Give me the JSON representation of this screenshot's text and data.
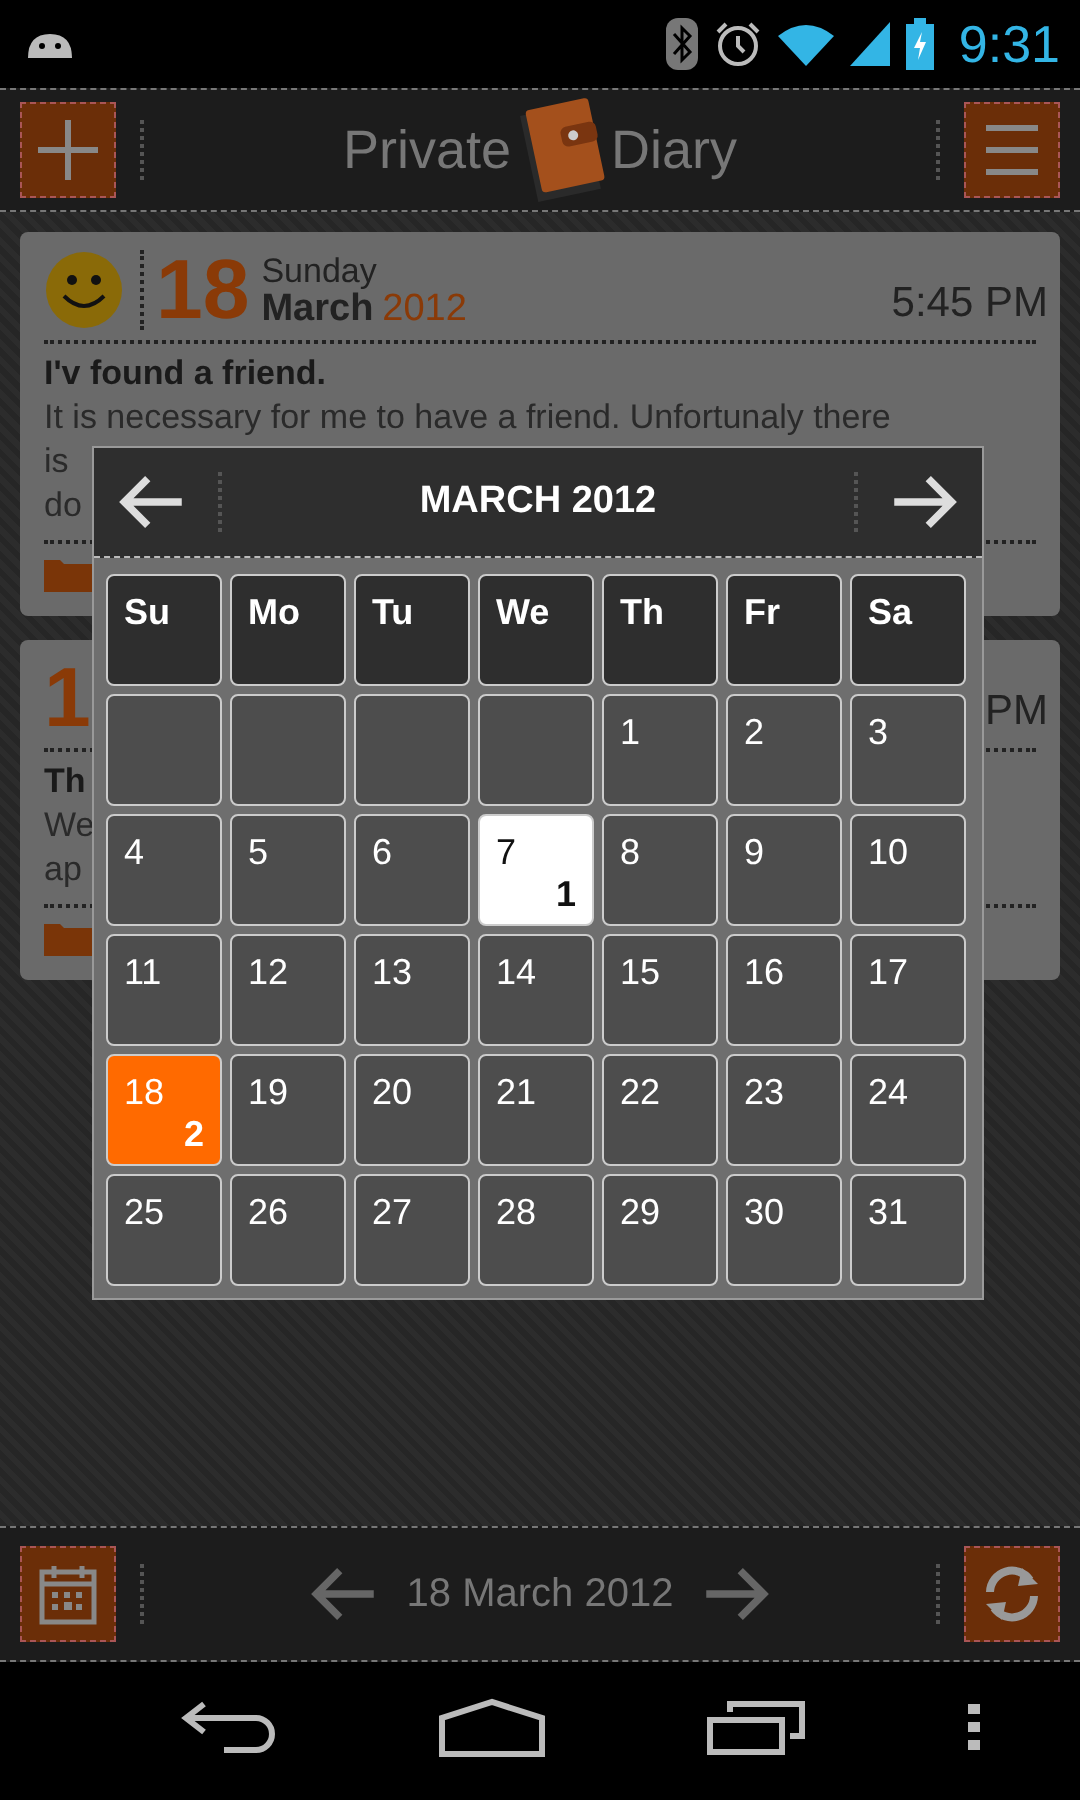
{
  "status_bar": {
    "time": "9:31"
  },
  "header": {
    "title_left": "Private",
    "title_right": "Diary"
  },
  "entries": [
    {
      "day": "18",
      "weekday": "Sunday",
      "month": "March",
      "year": "2012",
      "time": "5:45 PM",
      "title": "I'v found a friend.",
      "lines": [
        "It is necessary for me to have a friend. Unfortunaly there",
        "is",
        "do"
      ]
    },
    {
      "day": "1",
      "time": "PM",
      "title": "Th",
      "lines": [
        "We",
        "ap"
      ]
    }
  ],
  "calendar": {
    "title": "MARCH 2012",
    "weekdays": [
      "Su",
      "Mo",
      "Tu",
      "We",
      "Th",
      "Fr",
      "Sa"
    ],
    "days": [
      {
        "kind": "blank"
      },
      {
        "kind": "blank"
      },
      {
        "kind": "blank"
      },
      {
        "kind": "blank"
      },
      {
        "kind": "day",
        "day": "1",
        "selected": false,
        "highlighted": false
      },
      {
        "kind": "day",
        "day": "2",
        "selected": false,
        "highlighted": false
      },
      {
        "kind": "day",
        "day": "3",
        "selected": false,
        "highlighted": false
      },
      {
        "kind": "day",
        "day": "4",
        "selected": false,
        "highlighted": false
      },
      {
        "kind": "day",
        "day": "5",
        "selected": false,
        "highlighted": false
      },
      {
        "kind": "day",
        "day": "6",
        "selected": false,
        "highlighted": false
      },
      {
        "kind": "day",
        "day": "7",
        "count": "1",
        "selected": false,
        "highlighted": true
      },
      {
        "kind": "day",
        "day": "8",
        "selected": false,
        "highlighted": false
      },
      {
        "kind": "day",
        "day": "9",
        "selected": false,
        "highlighted": false
      },
      {
        "kind": "day",
        "day": "10",
        "selected": false,
        "highlighted": false
      },
      {
        "kind": "day",
        "day": "11",
        "selected": false,
        "highlighted": false
      },
      {
        "kind": "day",
        "day": "12",
        "selected": false,
        "highlighted": false
      },
      {
        "kind": "day",
        "day": "13",
        "selected": false,
        "highlighted": false
      },
      {
        "kind": "day",
        "day": "14",
        "selected": false,
        "highlighted": false
      },
      {
        "kind": "day",
        "day": "15",
        "selected": false,
        "highlighted": false
      },
      {
        "kind": "day",
        "day": "16",
        "selected": false,
        "highlighted": false
      },
      {
        "kind": "day",
        "day": "17",
        "selected": false,
        "highlighted": false
      },
      {
        "kind": "day",
        "day": "18",
        "count": "2",
        "selected": true,
        "highlighted": false
      },
      {
        "kind": "day",
        "day": "19",
        "selected": false,
        "highlighted": false
      },
      {
        "kind": "day",
        "day": "20",
        "selected": false,
        "highlighted": false
      },
      {
        "kind": "day",
        "day": "21",
        "selected": false,
        "highlighted": false
      },
      {
        "kind": "day",
        "day": "22",
        "selected": false,
        "highlighted": false
      },
      {
        "kind": "day",
        "day": "23",
        "selected": false,
        "highlighted": false
      },
      {
        "kind": "day",
        "day": "24",
        "selected": false,
        "highlighted": false
      },
      {
        "kind": "day",
        "day": "25",
        "selected": false,
        "highlighted": false
      },
      {
        "kind": "day",
        "day": "26",
        "selected": false,
        "highlighted": false
      },
      {
        "kind": "day",
        "day": "27",
        "selected": false,
        "highlighted": false
      },
      {
        "kind": "day",
        "day": "28",
        "selected": false,
        "highlighted": false
      },
      {
        "kind": "day",
        "day": "29",
        "selected": false,
        "highlighted": false
      },
      {
        "kind": "day",
        "day": "30",
        "selected": false,
        "highlighted": false
      },
      {
        "kind": "day",
        "day": "31",
        "selected": false,
        "highlighted": false
      }
    ]
  },
  "footer": {
    "date": "18 March 2012"
  }
}
